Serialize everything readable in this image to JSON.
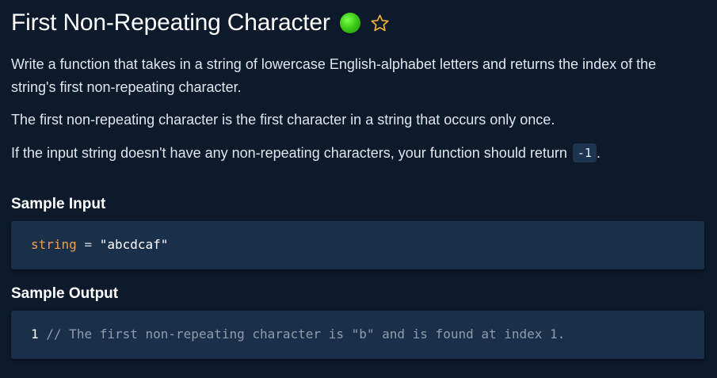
{
  "problem": {
    "title": "First Non-Repeating Character",
    "status_color": "#3fcc19",
    "star_color": "#f5b733"
  },
  "description": {
    "p1": "Write a function that takes in a string of lowercase English-alphabet letters and returns the index of the string's first non-repeating character.",
    "p2": "The first non-repeating character is the first character in a string that occurs only once.",
    "p3_before": "If the input string doesn't have any non-repeating characters, your function should return ",
    "p3_code": "-1",
    "p3_after": "."
  },
  "sample_input": {
    "heading": "Sample Input",
    "var_name": "string",
    "operator": "=",
    "value": "\"abcdcaf\""
  },
  "sample_output": {
    "heading": "Sample Output",
    "line_number": "1",
    "comment": "// The first non-repeating character is \"b\" and is found at index 1."
  }
}
